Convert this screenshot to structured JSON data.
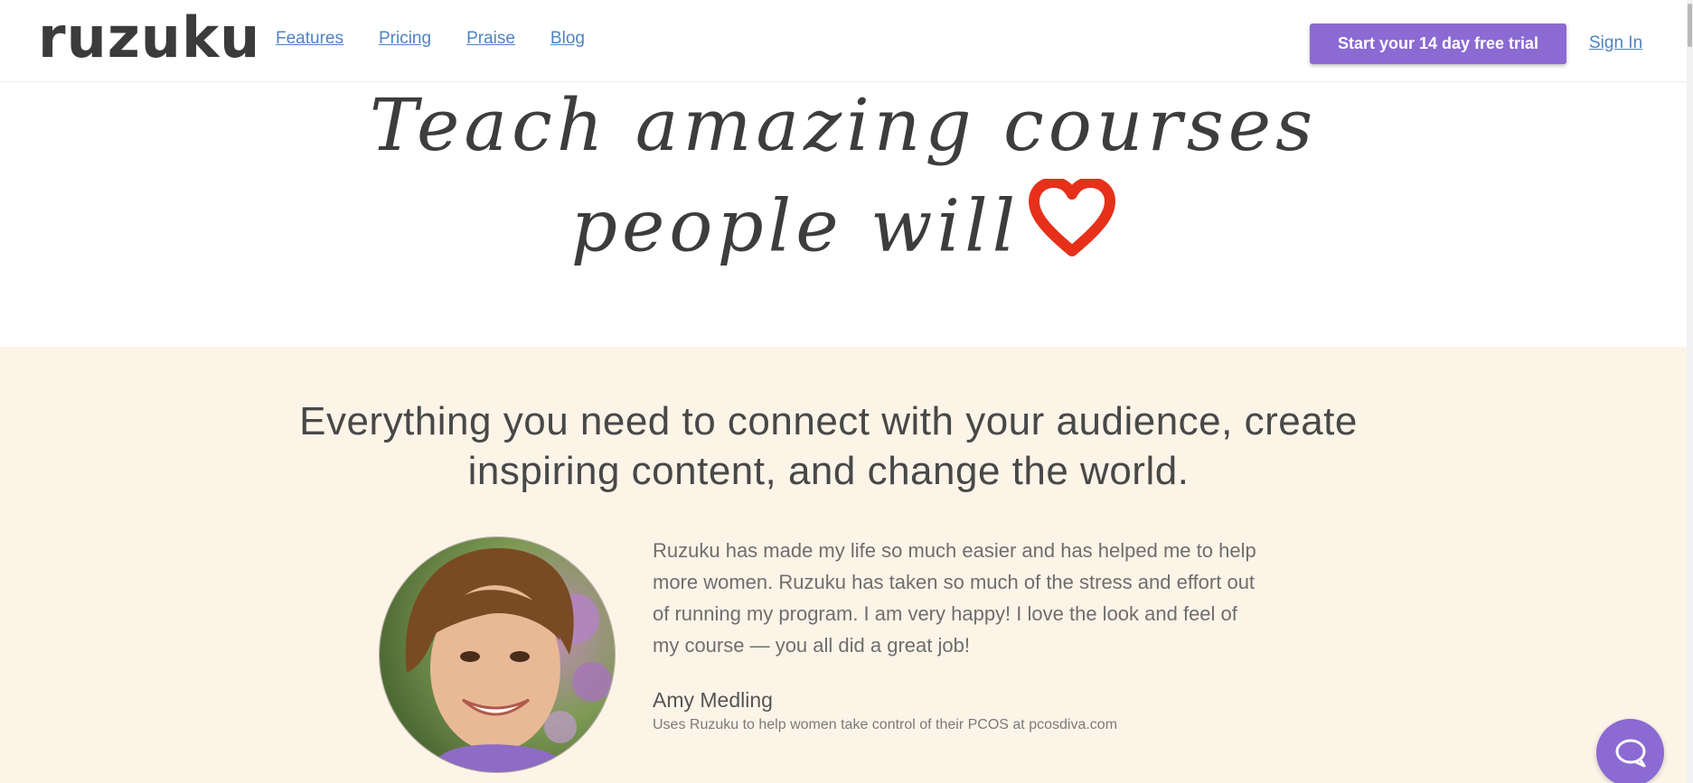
{
  "header": {
    "logo": "ruzuku",
    "nav": [
      "Features",
      "Pricing",
      "Praise",
      "Blog"
    ],
    "cta_label": "Start your 14 day free trial",
    "signin_label": "Sign In"
  },
  "hero": {
    "line1": "Teach amazing courses",
    "line2": "people will",
    "heart_icon": "heart-icon"
  },
  "feature": {
    "title_line1": "Everything you need to connect with your audience, create",
    "title_line2": "inspiring content, and change the world."
  },
  "testimonial": {
    "quote_lines": [
      "Ruzuku has made my life so much easier and has helped me to help",
      "more women. Ruzuku has taken so much of the stress and effort out",
      "of running my program. I am very happy! I love the look and feel of",
      "my course — you all did a great job!"
    ],
    "author": "Amy Medling",
    "author_description": "Uses Ruzuku to help women take control of their PCOS at pcosdiva.com"
  },
  "chat": {
    "icon": "chat-bubble-icon"
  },
  "colors": {
    "accent": "#8b6ad3",
    "link": "#4f83c2",
    "band_background": "#fdf4e8",
    "heart": "#e6301a"
  }
}
